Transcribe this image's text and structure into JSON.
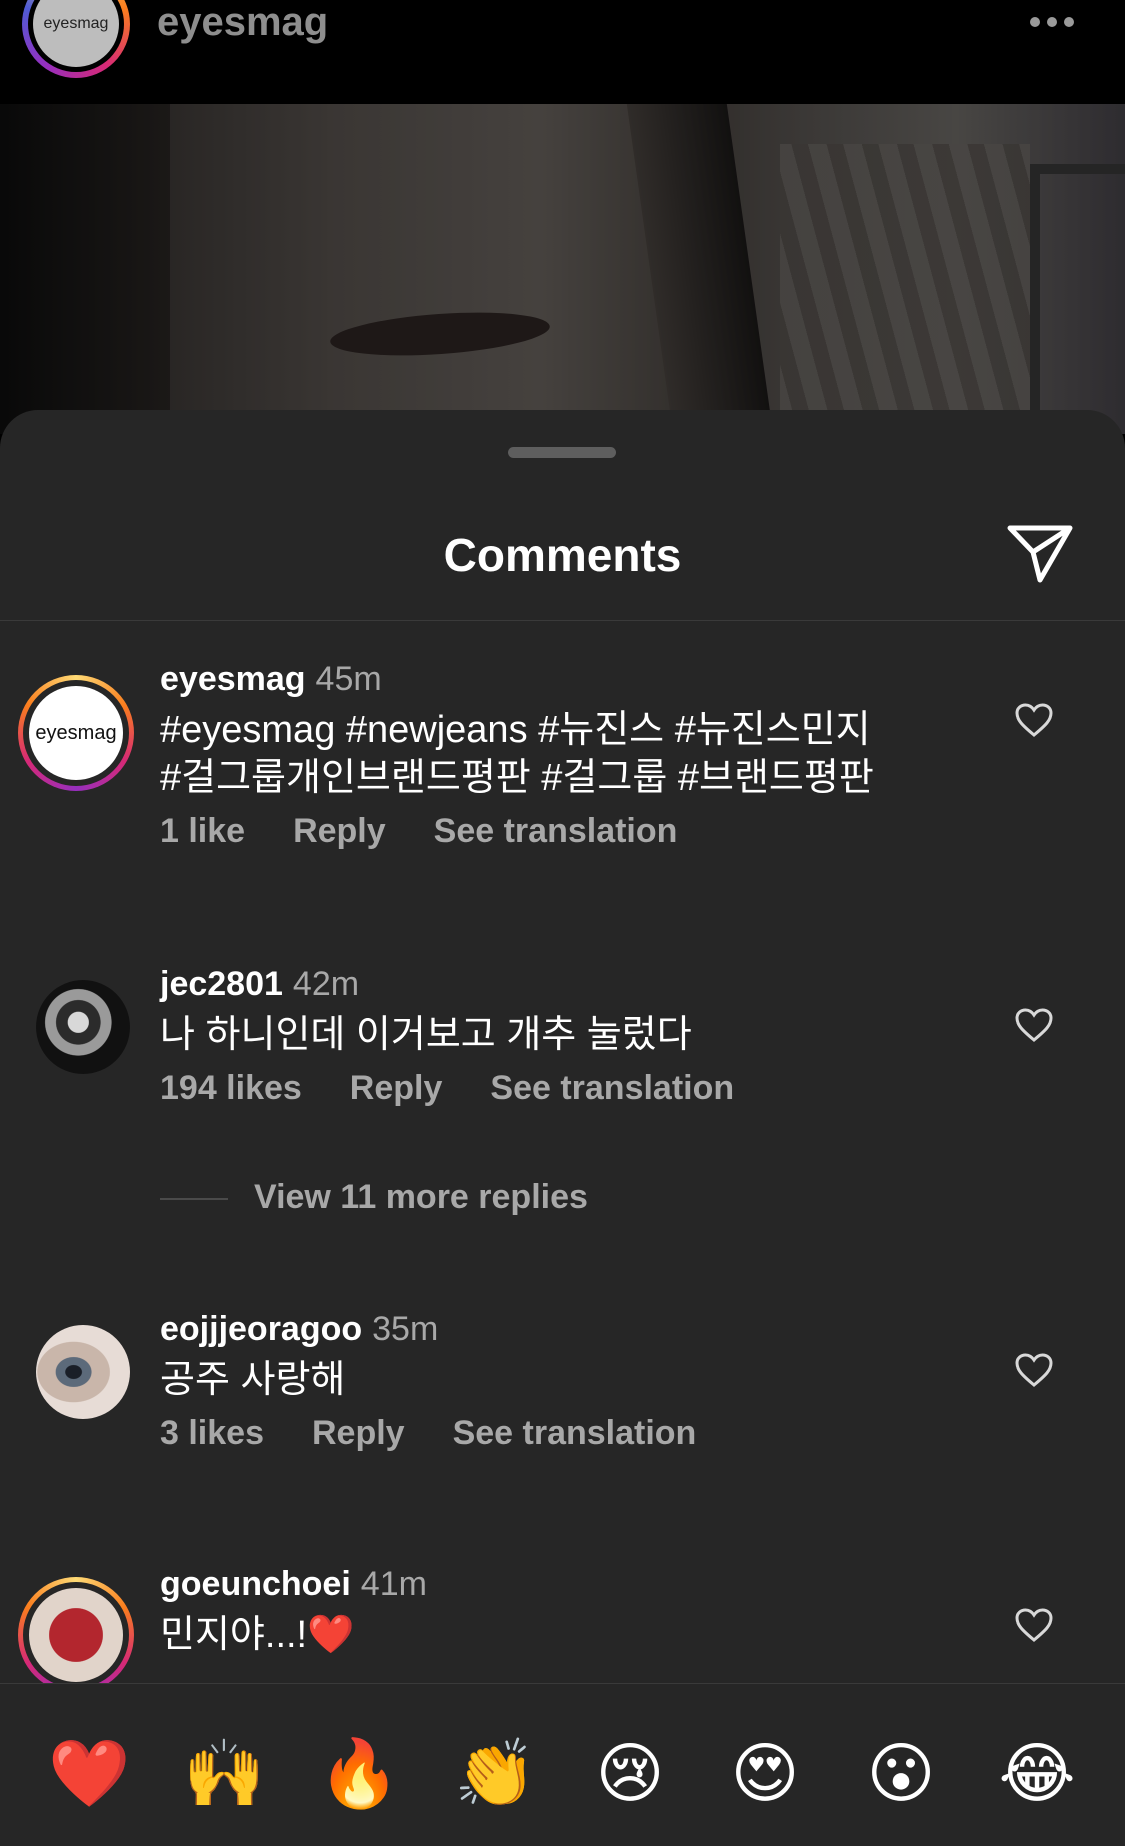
{
  "header": {
    "account": "eyesmag",
    "avatar_text": "eyesmag"
  },
  "sheet": {
    "title": "Comments"
  },
  "comments": [
    {
      "username": "eyesmag",
      "time": "45m",
      "avatar_text": "eyesmag",
      "text_line1": "#eyesmag #newjeans #뉴진스 #뉴진스민지",
      "text_line2": "#걸그룹개인브랜드평판 #걸그룹 #브랜드평판",
      "likes": "1 like",
      "reply": "Reply",
      "translate": "See translation"
    },
    {
      "username": "jec2801",
      "time": "42m",
      "text_line1": "나 하니인데 이거보고 개추 눌렀다",
      "likes": "194 likes",
      "reply": "Reply",
      "translate": "See translation",
      "more_replies": "View 11 more replies"
    },
    {
      "username": "eojjjeoragoo",
      "time": "35m",
      "text_line1": "공주 사랑해",
      "likes": "3 likes",
      "reply": "Reply",
      "translate": "See translation"
    },
    {
      "username": "goeunchoei",
      "time": "41m",
      "text_line1": "민지야...!❤️"
    }
  ],
  "reactions": [
    "❤️",
    "🙌",
    "🔥",
    "👏",
    "😢",
    "😍",
    "😮",
    "😂"
  ],
  "colors": {
    "sheet_bg": "#262626",
    "secondary_text": "#a8a8a8"
  }
}
